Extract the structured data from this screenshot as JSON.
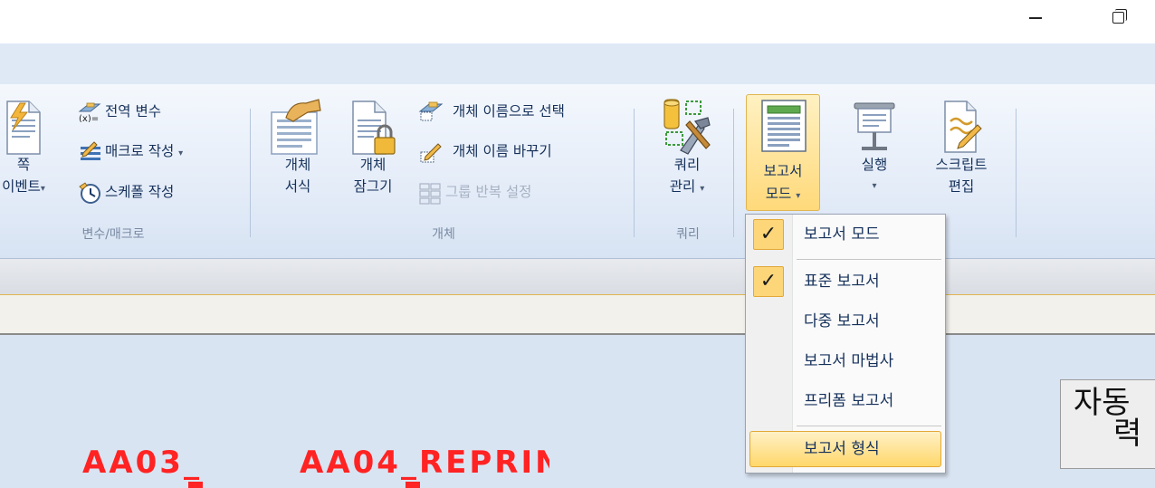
{
  "window": {
    "minimize_icon": "minimize-icon",
    "restore_icon": "restore-icon"
  },
  "ribbon": {
    "groups": {
      "variables_macros": {
        "label": "변수/매크로",
        "event_button": {
          "line1": "쪽",
          "line2": "이벤트",
          "caret": "▾"
        },
        "global_variables": "전역 변수",
        "macro_write": "매크로 작성",
        "macro_caret": "▾",
        "schedule_write": "스케폴 작성"
      },
      "objects": {
        "label": "개체",
        "object_format": {
          "line1": "개체",
          "line2": "서식"
        },
        "object_lock": {
          "line1": "개체",
          "line2": "잠그기"
        },
        "select_by_name": "개체 이름으로 선택",
        "rename_object": "개체 이름 바꾸기",
        "group_repeat": "그룹 반복 설정"
      },
      "query": {
        "label": "쿼리",
        "query_manage": {
          "line1": "쿼리",
          "line2": "관리",
          "caret": "▾"
        }
      },
      "report_mode": {
        "line1": "보고서",
        "line2": "모드",
        "caret": "▾"
      },
      "run": {
        "line1": "실행",
        "caret": "▾"
      },
      "script_edit": {
        "line1": "스크립트",
        "line2": "편집"
      }
    }
  },
  "dropdown": {
    "items": [
      {
        "label": "보고서 모드",
        "checked": true,
        "check": "✓"
      },
      {
        "label": "표준 보고서",
        "checked": true,
        "check": "✓"
      },
      {
        "label": "다중 보고서",
        "checked": false
      },
      {
        "label": "보고서 마법사",
        "checked": false
      },
      {
        "label": "프리폼 보고서",
        "checked": false
      },
      {
        "label": "보고서 형식",
        "highlighted": true
      }
    ]
  },
  "canvas": {
    "field1": "AA03_",
    "field2": "AA04_REPRIN",
    "auto_box": {
      "line1": "자동",
      "line2": "력"
    }
  },
  "colors": {
    "accent": "#ffd97a",
    "field_red": "#ff2323",
    "ribbon_text": "#15305a"
  }
}
